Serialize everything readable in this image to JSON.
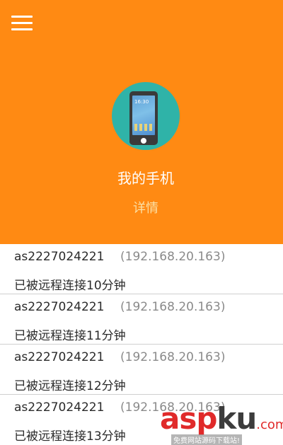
{
  "header": {
    "menu_icon": "hamburger-menu-icon",
    "background_color": "#ff8a13",
    "avatar_icon": "phone-icon",
    "avatar_color": "#2fb3a8",
    "phone_screen_time": "16:30",
    "phone_name": "我的手机",
    "details_label": "详情"
  },
  "connections": [
    {
      "host": "as2227024221",
      "ip": "(192.168.20.163)",
      "status": "已被远程连接10分钟"
    },
    {
      "host": "as2227024221",
      "ip": "(192.168.20.163)",
      "status": "已被远程连接11分钟"
    },
    {
      "host": "as2227024221",
      "ip": "(192.168.20.163)",
      "status": "已被远程连接12分钟"
    },
    {
      "host": "as2227024221",
      "ip": "(192.168.20.163)",
      "status": "已被远程连接13分钟"
    }
  ],
  "watermark": {
    "part1": "asp",
    "part2": "ku",
    "part3": ".com",
    "subtitle": "免费网站源码下载站!"
  }
}
